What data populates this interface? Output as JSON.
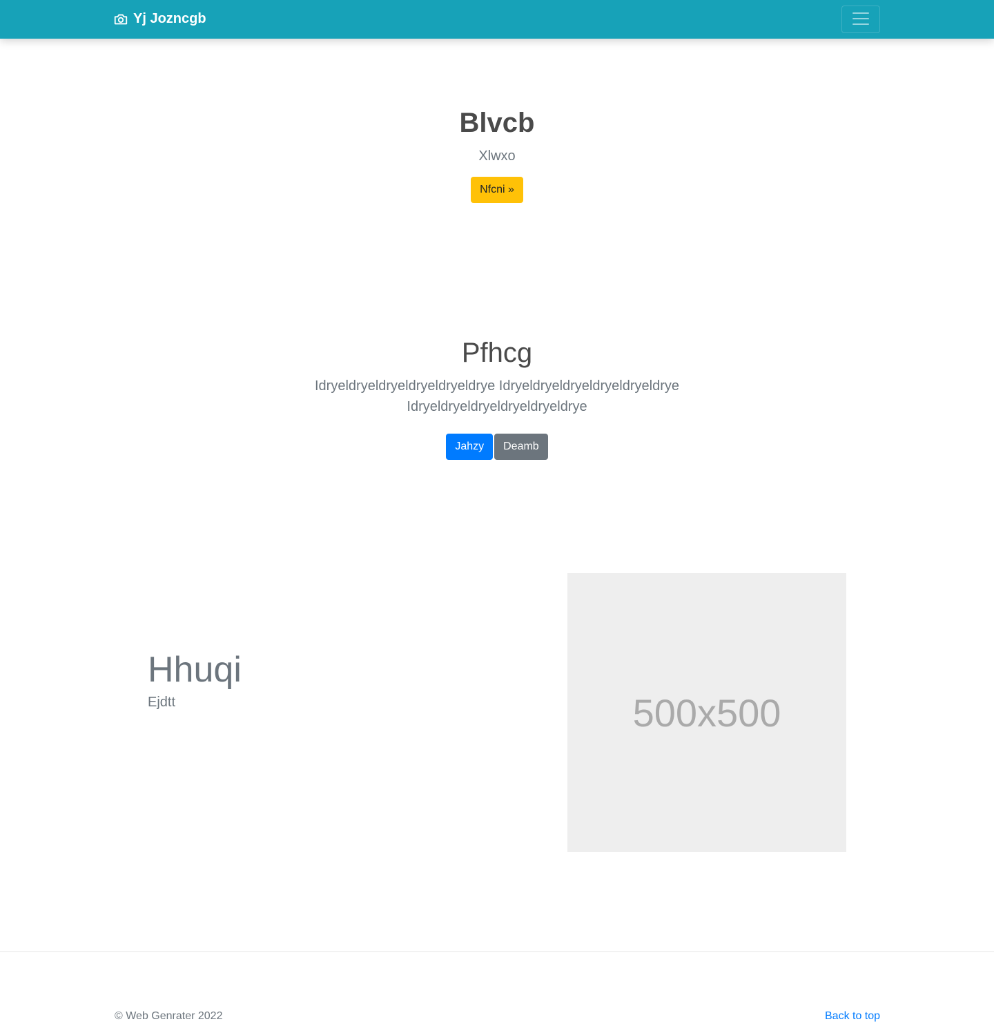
{
  "navbar": {
    "brand_label": "Yj Jozncgb",
    "brand_icon": "camera-icon",
    "toggler_icon": "hamburger-menu-icon",
    "background_color": "#17a2b8"
  },
  "hero": {
    "title": "Blvcb",
    "subtitle": "Xlwxo",
    "button_label": "Nfcni »",
    "button_color": "#ffc107"
  },
  "section2": {
    "title": "Pfhcg",
    "text": "Idryeldryeldryeldryeldryeldrye Idryeldryeldryeldryeldryeldrye Idryeldryeldryeldryeldryeldrye",
    "primary_button_label": "Jahzy",
    "secondary_button_label": "Deamb"
  },
  "feature": {
    "title": "Hhuqi",
    "subtitle": "Ejdtt",
    "image_placeholder_text": "500x500"
  },
  "footer": {
    "copyright": "© Web Genrater 2022",
    "back_to_top_label": "Back to top"
  }
}
